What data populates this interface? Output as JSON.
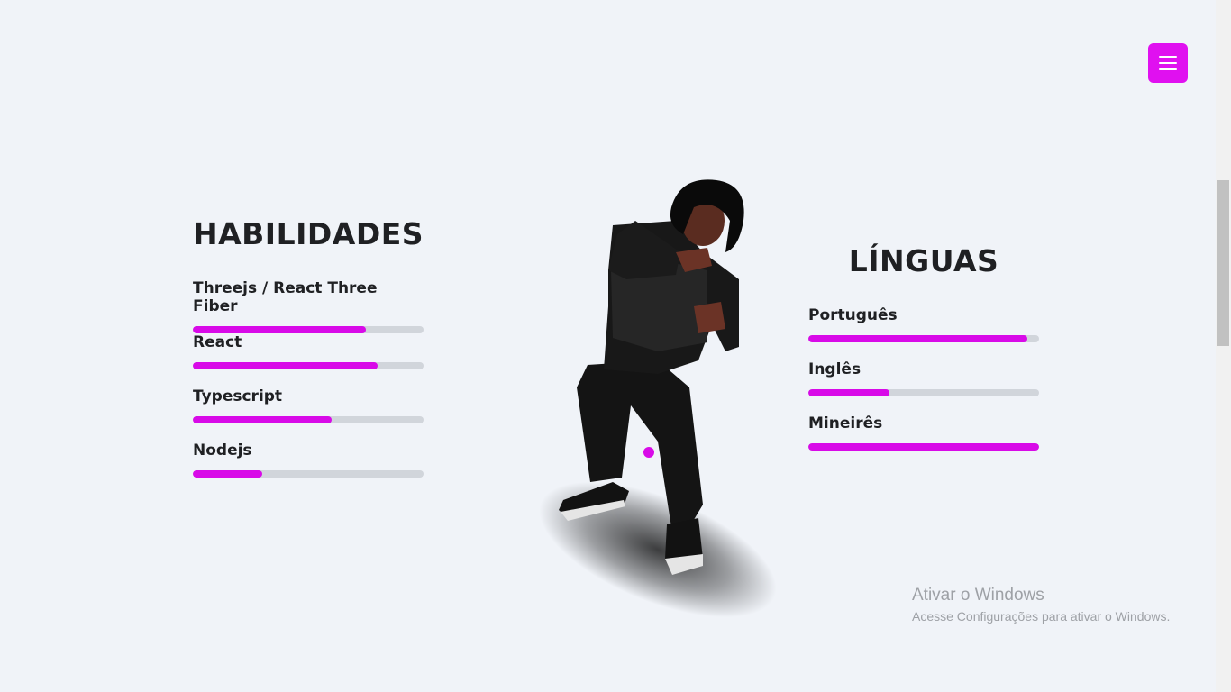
{
  "menu": {
    "icon": "hamburger-menu-icon",
    "color": "#e010f0"
  },
  "skills": {
    "title": "HABILIDADES",
    "items": [
      {
        "name": "Threejs / React Three Fiber",
        "level": 0.75
      },
      {
        "name": "React",
        "level": 0.8
      },
      {
        "name": "Typescript",
        "level": 0.6
      },
      {
        "name": "Nodejs",
        "level": 0.3
      }
    ]
  },
  "languages": {
    "title": "LÍNGUAS",
    "items": [
      {
        "name": "Português",
        "level": 0.95
      },
      {
        "name": "Inglês",
        "level": 0.35
      },
      {
        "name": "Mineirês",
        "level": 1.0
      }
    ]
  },
  "colors": {
    "accent": "#d80ae8",
    "track": "#d1d5db",
    "background": "#f0f3f8"
  },
  "watermark": {
    "title": "Ativar o Windows",
    "subtitle": "Acesse Configurações para ativar o Windows."
  }
}
